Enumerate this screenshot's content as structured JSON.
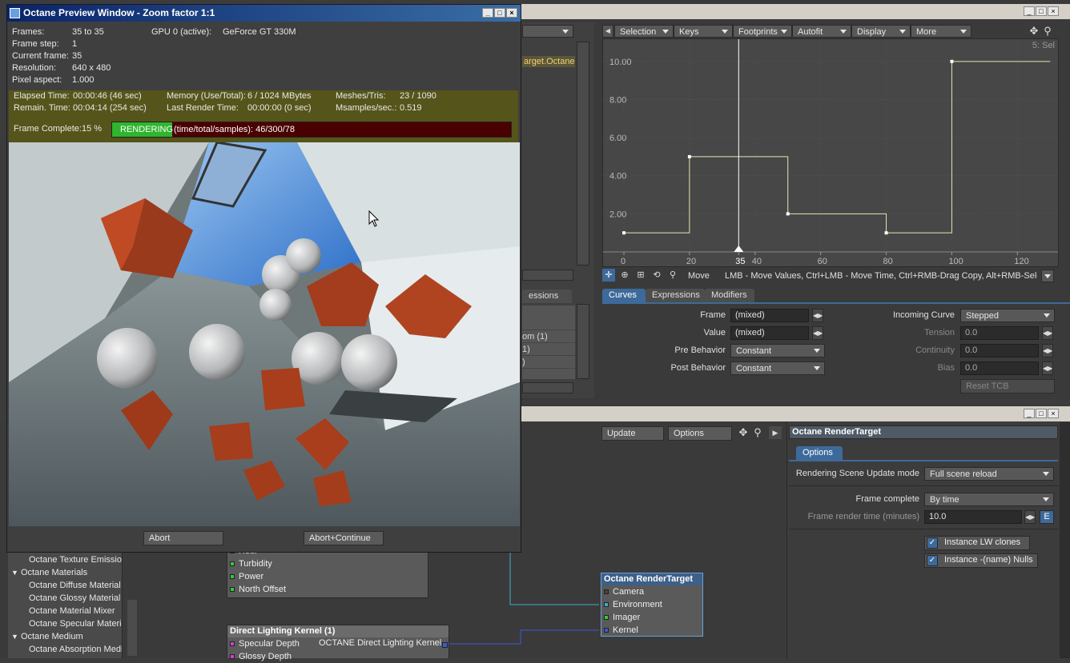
{
  "octane_window": {
    "title": "Octane Preview Window - Zoom factor 1:1",
    "frames_label": "Frames:",
    "frames_value": "35 to 35",
    "gpu_label": "GPU  0 (active):",
    "gpu_value": "GeForce GT 330M",
    "frame_step_label": "Frame step:",
    "frame_step_value": "1",
    "current_frame_label": "Current frame:",
    "current_frame_value": "35",
    "resolution_label": "Resolution:",
    "resolution_value": "640 x 480",
    "pixel_aspect_label": "Pixel aspect:",
    "pixel_aspect_value": "1.000",
    "elapsed_label": "Elapsed Time:",
    "elapsed_value": "00:00:46 (46 sec)",
    "remain_label": "Remain. Time:",
    "remain_value": "00:04:14 (254 sec)",
    "memory_label": "Memory (Use/Total):",
    "memory_value": "6 / 1024 MBytes",
    "last_render_label": "Last Render Time:",
    "last_render_value": "00:00:00 (0 sec)",
    "meshes_label": "Meshes/Tris:",
    "meshes_value": "23 / 1090",
    "msamples_label": "Msamples/sec.:",
    "msamples_value": "0.519",
    "frame_complete_label": "Frame Complete:",
    "frame_complete_value": "15 %",
    "progress_fraction": 0.15,
    "rendering_label": "RENDERING",
    "progress_text": "(time/total/samples): 46/300/78",
    "abort_label": "Abort",
    "abort_continue_label": "Abort+Continue"
  },
  "graph_editor": {
    "toolbar": [
      "Selection",
      "Keys",
      "Footprints",
      "Autofit",
      "Display",
      "More"
    ],
    "channel_label": "arget.Octane",
    "corner_label": "5: Sel",
    "y_ticks": [
      "10.00",
      "8.00",
      "6.00",
      "4.00",
      "2.00"
    ],
    "x_ticks": [
      "0",
      "20",
      "35",
      "40",
      "60",
      "80",
      "100",
      "120"
    ],
    "mode_label": "Move",
    "hint": "LMB - Move Values, Ctrl+LMB - Move Time, Ctrl+RMB-Drag Copy, Alt+RMB-Sele...",
    "tabs": [
      "Curves",
      "Expressions",
      "Modifiers"
    ],
    "left_tab": "essions",
    "list_items": [
      "",
      "om (1)",
      "1)",
      ")"
    ],
    "frame_label": "Frame",
    "frame_value": "(mixed)",
    "value_label": "Value",
    "value_value": "(mixed)",
    "pre_behavior_label": "Pre Behavior",
    "pre_behavior_value": "Constant",
    "post_behavior_label": "Post Behavior",
    "post_behavior_value": "Constant",
    "incoming_curve_label": "Incoming Curve",
    "incoming_curve_value": "Stepped",
    "tension_label": "Tension",
    "tension_value": "0.0",
    "continuity_label": "Continuity",
    "continuity_value": "0.0",
    "bias_label": "Bias",
    "bias_value": "0.0",
    "reset_tcb_label": "Reset TCB"
  },
  "chart_data": {
    "type": "line",
    "x": [
      0,
      20,
      20,
      50,
      50,
      80,
      80,
      100,
      100,
      130
    ],
    "y": [
      1.0,
      1.0,
      5.0,
      5.0,
      2.0,
      2.0,
      1.0,
      1.0,
      10.0,
      10.0
    ],
    "xlim": [
      0,
      130
    ],
    "ylim": [
      0,
      11
    ],
    "current_frame": 35,
    "keys": [
      [
        0,
        1.0
      ],
      [
        20,
        5.0
      ],
      [
        50,
        2.0
      ],
      [
        80,
        1.0
      ],
      [
        100,
        10.0
      ]
    ]
  },
  "node_editor": {
    "update_label": "Update",
    "options_label": "Options",
    "sky_node_ports": [
      "Hour",
      "Turbidity",
      "Power",
      "North Offset"
    ],
    "dl_node_title": "Direct Lighting Kernel (1)",
    "dl_node_ports": [
      "Specular Depth",
      "Glossy Depth"
    ],
    "dl_node_output": "OCTANE Direct Lighting Kernel",
    "rt_node_title": "Octane RenderTarget",
    "rt_node_ports": [
      "Camera",
      "Environment",
      "Imager",
      "Kernel"
    ]
  },
  "properties": {
    "title": "Octane RenderTarget",
    "tab": "Options",
    "update_mode_label": "Rendering Scene Update mode",
    "update_mode_value": "Full scene reload",
    "frame_complete_label": "Frame complete",
    "frame_complete_value": "By time",
    "frame_time_label": "Frame render time (minutes)",
    "frame_time_value": "10.0",
    "e_label": "E",
    "instance_lw_label": "Instance LW clones",
    "instance_nulls_label": "Instance -(name) Nulls"
  },
  "tree": {
    "items": [
      {
        "label": "Octane Texture Emission",
        "indent": 2
      },
      {
        "label": "Octane Materials",
        "indent": 1,
        "expanded": true
      },
      {
        "label": "Octane Diffuse Material",
        "indent": 2
      },
      {
        "label": "Octane Glossy Material",
        "indent": 2
      },
      {
        "label": "Octane Material Mixer",
        "indent": 2
      },
      {
        "label": "Octane Specular Material",
        "indent": 2
      },
      {
        "label": "Octane Medium",
        "indent": 1,
        "expanded": true
      },
      {
        "label": "Octane Absorption Medium",
        "indent": 2
      }
    ]
  }
}
